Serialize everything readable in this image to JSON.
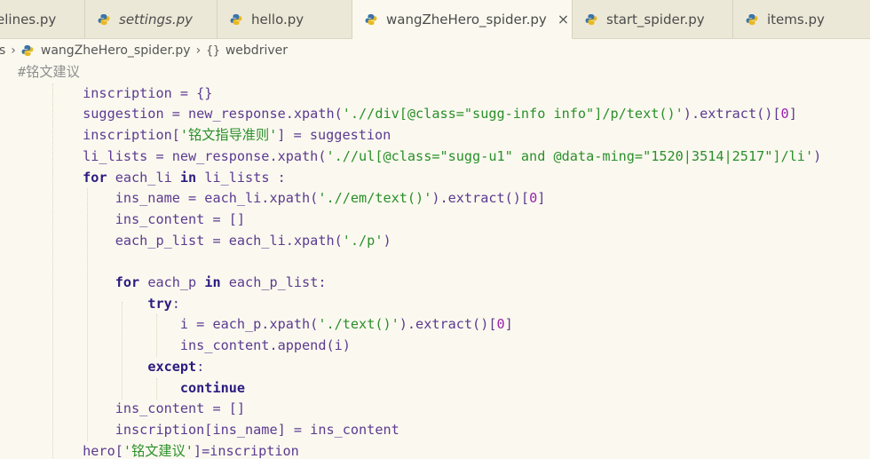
{
  "tabs": [
    {
      "label": "elines.py",
      "italic": false,
      "icon": "python-file-icon"
    },
    {
      "label": "settings.py",
      "italic": true,
      "icon": "python-file-icon"
    },
    {
      "label": "hello.py",
      "italic": false,
      "icon": "python-file-icon"
    },
    {
      "label": "wangZheHero_spider.py",
      "italic": false,
      "icon": "python-file-icon",
      "active": true,
      "close": "×"
    },
    {
      "label": "start_spider.py",
      "italic": false,
      "icon": "python-file-icon"
    },
    {
      "label": "items.py",
      "italic": false,
      "icon": "python-file-icon"
    }
  ],
  "breadcrumb": {
    "prefix": "s",
    "file": "wangZheHero_spider.py",
    "symbol_icon": "{}",
    "symbol": "webdriver"
  },
  "code": {
    "lines": [
      "#铭文建议",
      "        inscription = {}",
      "        suggestion = new_response.xpath('.//div[@class=\"sugg-info info\"]/p/text()').extract()[0]",
      "        inscription['铭文指导准则'] = suggestion",
      "        li_lists = new_response.xpath('.//ul[@class=\"sugg-u1\" and @data-ming=\"1520|3514|2517\"]/li')",
      "        for each_li in li_lists :",
      "            ins_name = each_li.xpath('.//em/text()').extract()[0]",
      "            ins_content = []",
      "            each_p_list = each_li.xpath('./p')",
      "",
      "            for each_p in each_p_list:",
      "                try:",
      "                    i = each_p.xpath('./text()').extract()[0]",
      "                    ins_content.append(i)",
      "                except:",
      "                    continue",
      "            ins_content = []",
      "            inscription[ins_name] = ins_content",
      "        hero['铭文建议']=inscription"
    ]
  },
  "colors": {
    "background": "#fbf9ef",
    "tabbar": "#ebe7d7",
    "identifier": "#5b3a91",
    "keyword": "#2c1b80",
    "string": "#2a8f2a",
    "number": "#9b1fb0",
    "comment": "#8e8e8e"
  }
}
